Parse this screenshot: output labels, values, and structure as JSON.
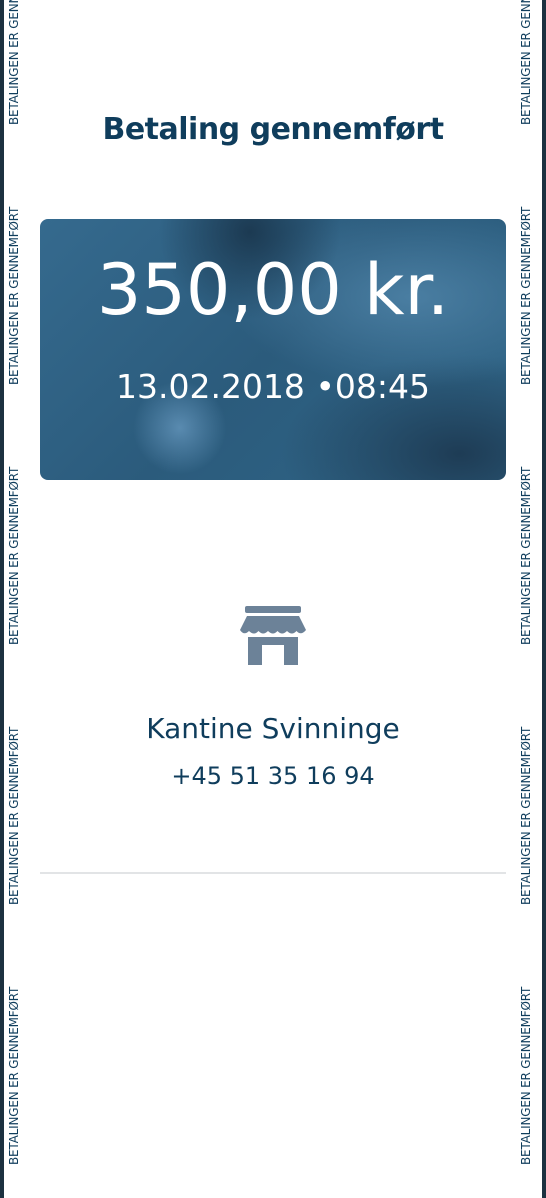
{
  "watermark": "BETALINGEN ER GENNEMFØRT",
  "header": {
    "title": "Betaling gennemført"
  },
  "payment": {
    "amount": "350,00 kr.",
    "date": "13.02.2018",
    "separator": "•",
    "time": "08:45"
  },
  "merchant": {
    "icon": "store-icon",
    "name": "Kantine Svinninge",
    "phone": "+45 51 35 16 94"
  },
  "colors": {
    "primary": "#0f3d5c",
    "icon": "#6c8298",
    "card": "#2f6386"
  }
}
